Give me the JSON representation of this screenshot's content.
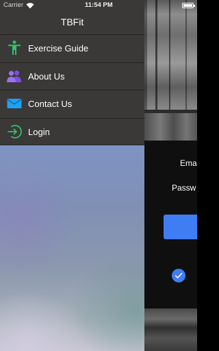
{
  "status_bar": {
    "carrier": "Carrier",
    "time": "11:54 PM"
  },
  "menu": {
    "title": "TBFit",
    "items": [
      {
        "label": "Exercise Guide",
        "icon": "person-icon",
        "icon_color": "#2fc36a"
      },
      {
        "label": "About Us",
        "icon": "users-icon",
        "icon_color": "#8a5ce6"
      },
      {
        "label": "Contact Us",
        "icon": "envelope-icon",
        "icon_color": "#1da1f2"
      },
      {
        "label": "Login",
        "icon": "login-arrow-icon",
        "icon_color": "#2fc36a"
      }
    ]
  },
  "login_screen": {
    "email_label": "Ema",
    "password_label": "Passw",
    "accent_color": "#3f7df4"
  }
}
